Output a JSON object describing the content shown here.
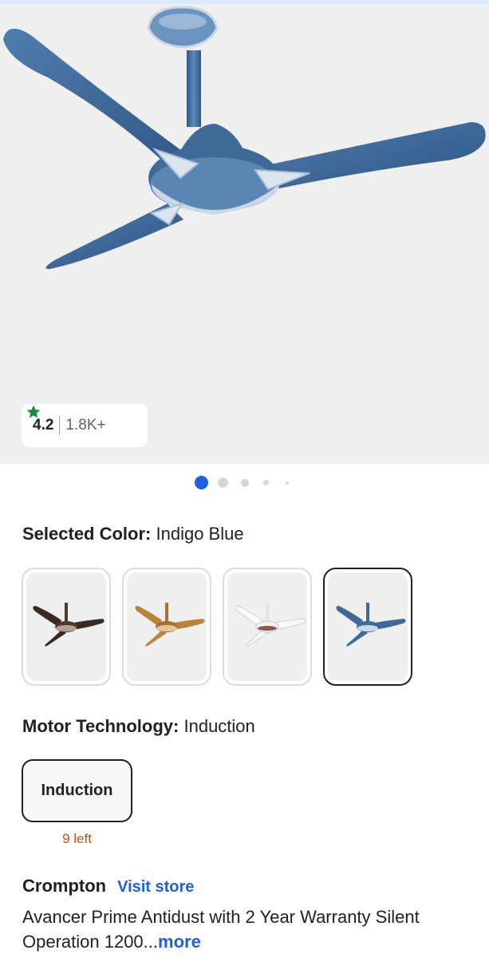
{
  "gallery": {
    "image": "indigo-blue-ceiling-fan-image",
    "rating_value": "4.2",
    "rating_icon": "star-icon",
    "rating_star_color": "#1b8a3a",
    "rating_count": "1.8K+",
    "pagination_dots": 5,
    "active_dot": 1,
    "accent_color": "#1f5fe0"
  },
  "color_selection": {
    "label": "Selected Color:",
    "value": "Indigo Blue",
    "swatches": [
      {
        "name": "brown-fan",
        "color": "#3b2a24",
        "selected": false
      },
      {
        "name": "gold-fan",
        "color": "#b8843a",
        "selected": false
      },
      {
        "name": "white-fan",
        "color": "#eeeeee",
        "selected": false
      },
      {
        "name": "indigo-fan",
        "color": "#3f6a98",
        "selected": true
      }
    ]
  },
  "motor_technology": {
    "label": "Motor Technology:",
    "value": "Induction",
    "options": [
      {
        "label": "Induction",
        "stock_note": "9 left"
      }
    ]
  },
  "product": {
    "brand": "Crompton",
    "visit_store": "Visit store",
    "title": "Avancer Prime Antidust with 2 Year Warranty Silent Operation 1200...",
    "more": "more"
  }
}
